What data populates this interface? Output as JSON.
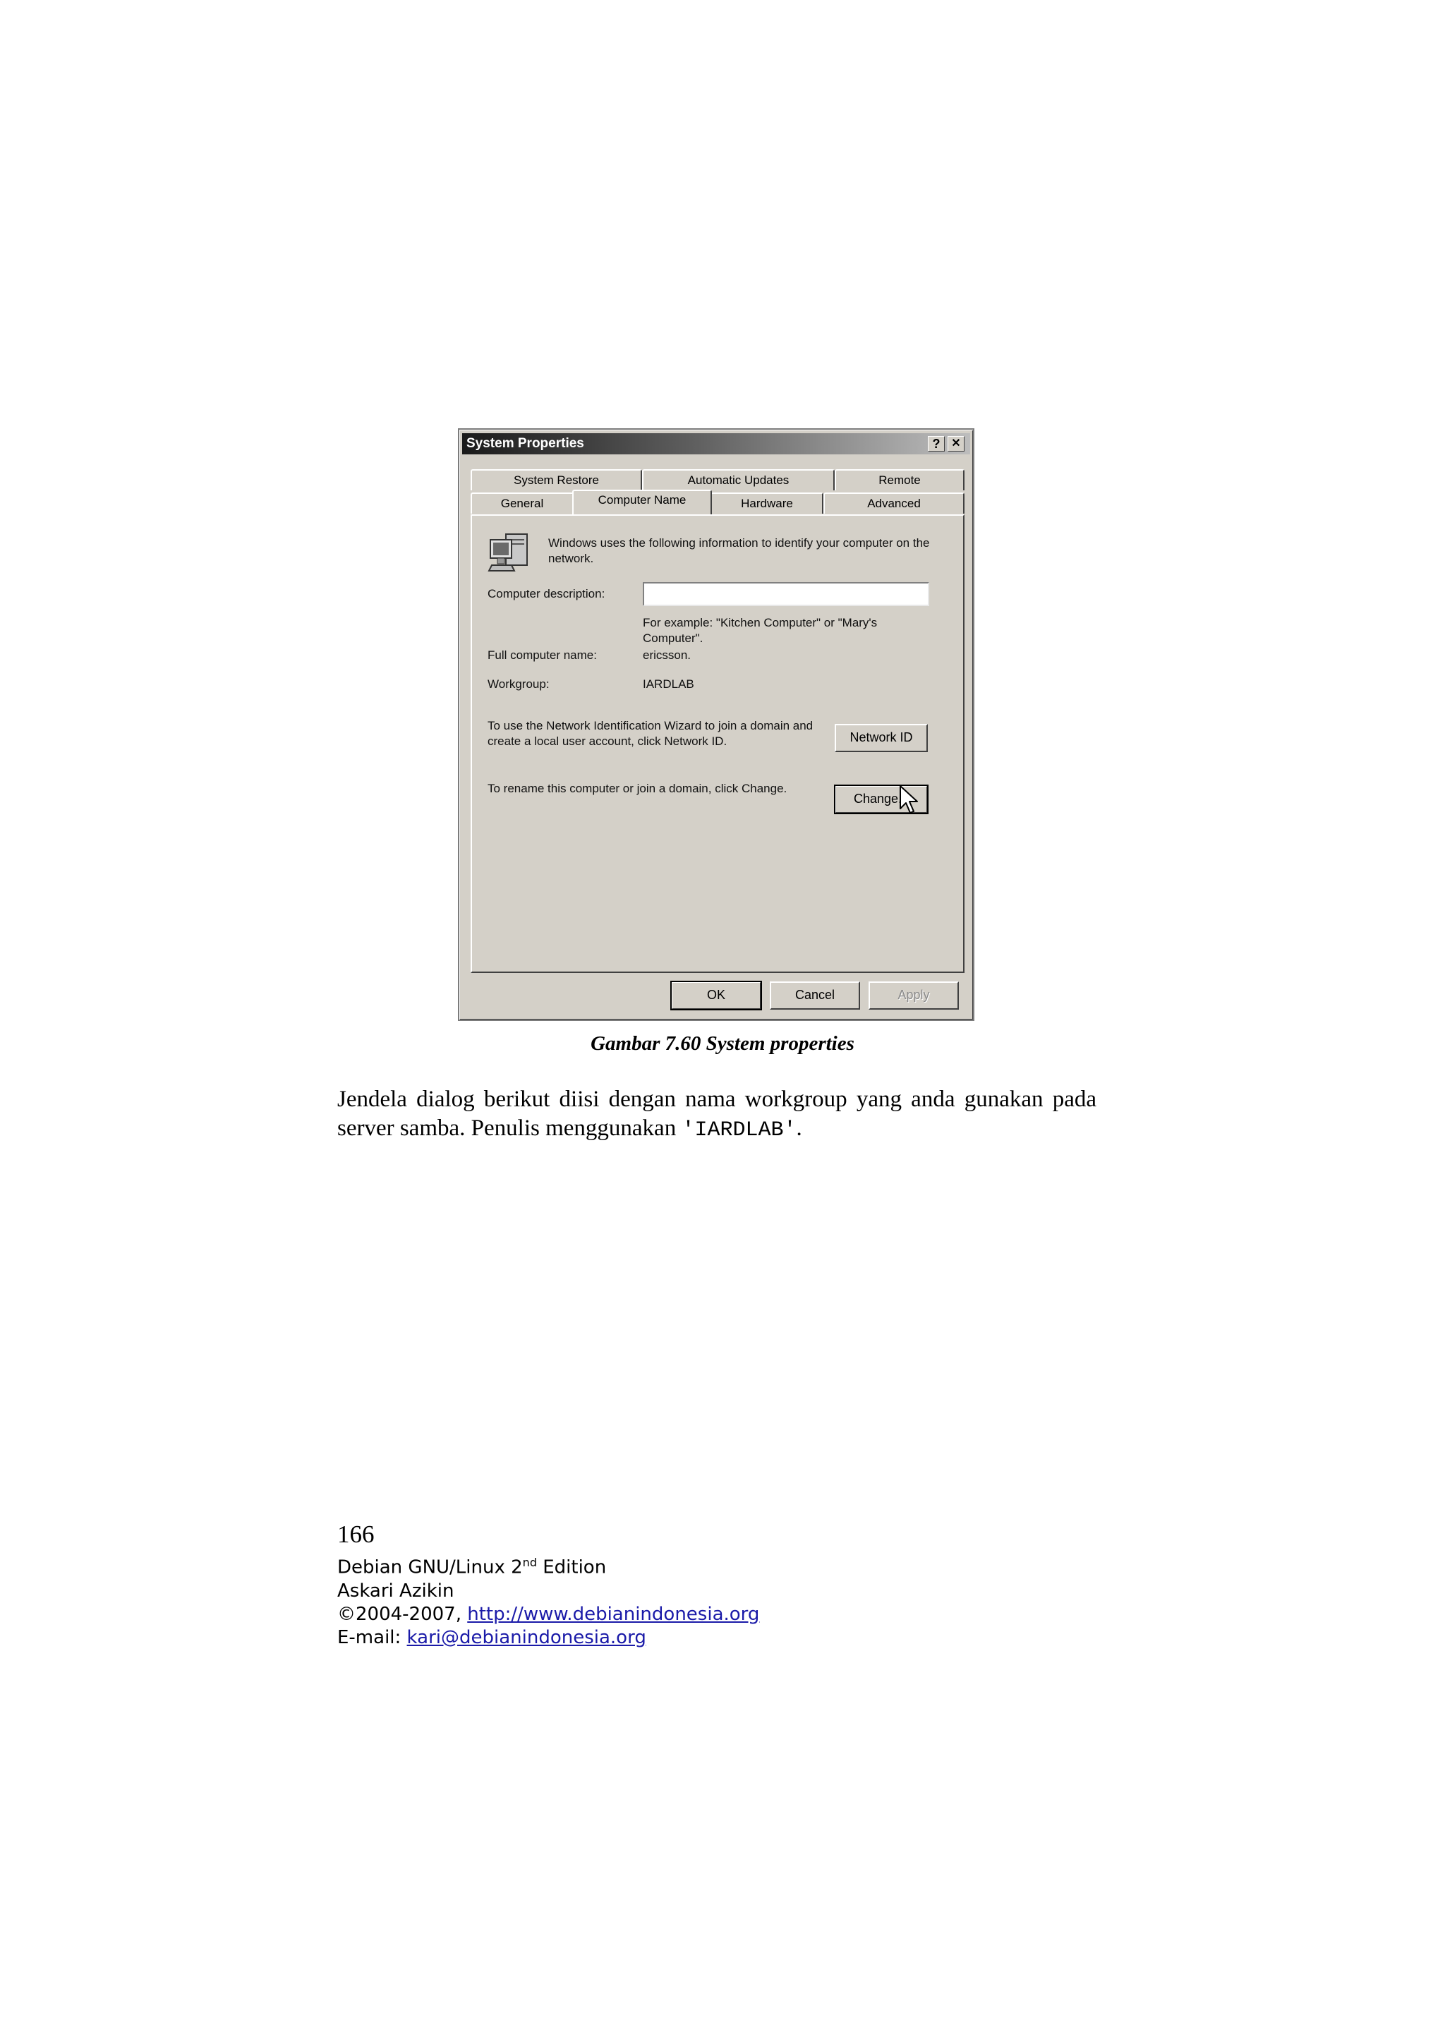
{
  "dialog": {
    "title": "System Properties",
    "help_button": "?",
    "close_button": "✕",
    "tabs_back_row": [
      "System Restore",
      "Automatic Updates",
      "Remote"
    ],
    "tabs_front_row": [
      "General",
      "Computer Name",
      "Hardware",
      "Advanced"
    ],
    "active_tab": "Computer Name",
    "intro": "Windows uses the following information to identify your computer on the network.",
    "description_label": "Computer description:",
    "description_value": "",
    "example_text": "For example: \"Kitchen Computer\" or \"Mary's Computer\".",
    "full_name_label": "Full computer name:",
    "full_name_value": "ericsson.",
    "workgroup_label": "Workgroup:",
    "workgroup_value": "IARDLAB",
    "network_id_text": "To use the Network Identification Wizard to join a domain and create a local user account, click Network ID.",
    "network_id_button": "Network ID",
    "rename_text": "To rename this computer or join a domain, click Change.",
    "change_button": "Change...",
    "ok_button": "OK",
    "cancel_button": "Cancel",
    "apply_button": "Apply",
    "icons": [
      "computer-icon",
      "mouse-pointer-icon"
    ]
  },
  "caption": "Gambar 7.60 System properties",
  "body": {
    "text_before": "Jendela dialog berikut diisi dengan nama workgroup yang anda gunakan pada server samba. Penulis menggunakan ",
    "code": "'IARDLAB'",
    "text_after": "."
  },
  "footer": {
    "page_number": "166",
    "book_title_prefix": "Debian GNU/Linux 2",
    "book_title_sup": "nd",
    "book_title_suffix": " Edition",
    "author": "Askari Azikin",
    "copyright_prefix": "©2004-2007, ",
    "website": "http://www.debianindonesia.org",
    "email_prefix": "E-mail: ",
    "email": "kari@debianindonesia.org",
    "link_color": "#1a1aa8"
  }
}
